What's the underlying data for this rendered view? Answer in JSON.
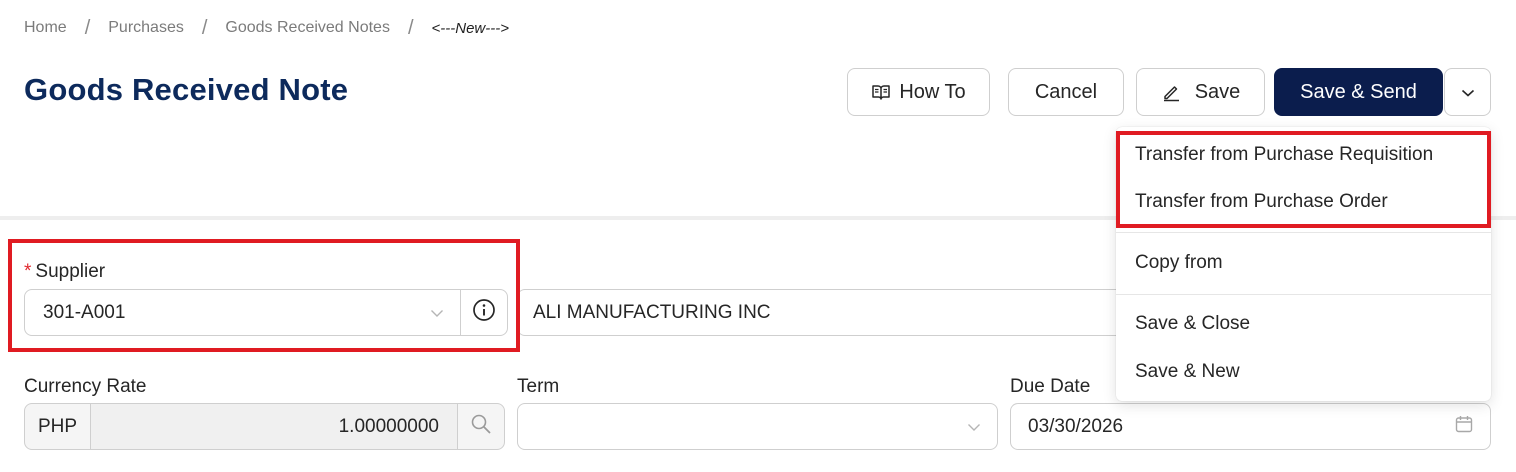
{
  "breadcrumb": {
    "home": "Home",
    "purchases": "Purchases",
    "grn": "Goods Received Notes",
    "current": "<---New--->",
    "sep": "/"
  },
  "page": {
    "title": "Goods Received Note"
  },
  "toolbar": {
    "howto_label": "How To",
    "cancel_label": "Cancel",
    "save_label": "Save",
    "save_send_label": "Save & Send",
    "primary_color": "#0b1d4d"
  },
  "dropdown": {
    "transfer_requisition": "Transfer from Purchase Requisition",
    "transfer_order": "Transfer from Purchase Order",
    "copy_from": "Copy from",
    "save_close": "Save & Close",
    "save_new": "Save & New"
  },
  "form": {
    "supplier_label": "Supplier",
    "supplier_required": "*",
    "supplier_code": "301-A001",
    "supplier_name": "ALI MANUFACTURING INC",
    "currency_label": "Currency Rate",
    "currency_code": "PHP",
    "currency_rate": "1.00000000",
    "term_label": "Term",
    "term_value": "",
    "due_label": "Due Date",
    "due_value": "03/30/2026"
  },
  "highlight_color": "#e01b22",
  "icons": [
    "book-icon",
    "pencil-icon",
    "chevron-down-icon",
    "info-icon",
    "search-icon",
    "calendar-icon"
  ]
}
